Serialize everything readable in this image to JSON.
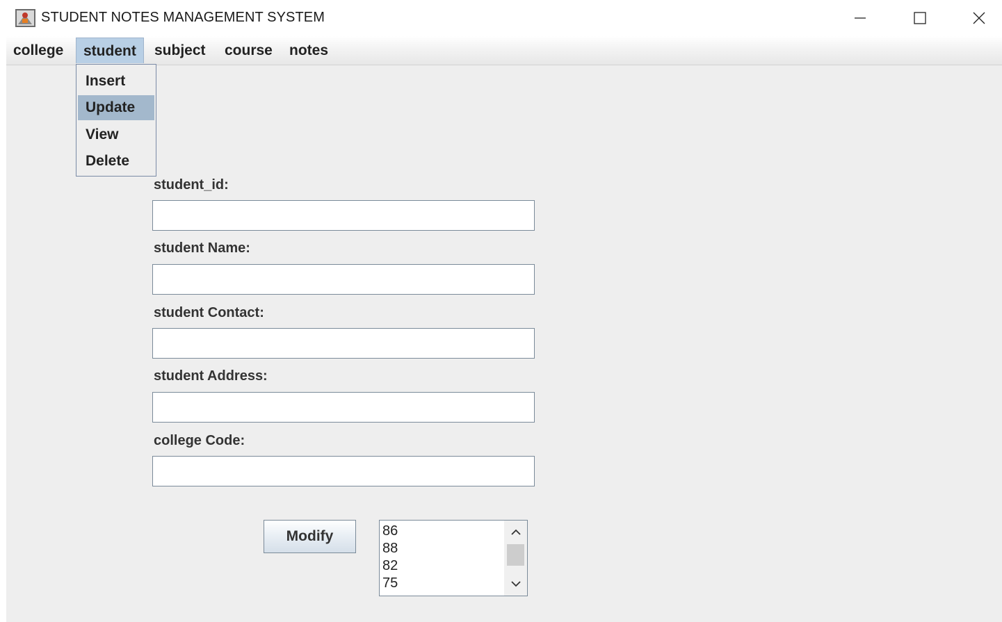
{
  "window": {
    "title": "STUDENT NOTES MANAGEMENT SYSTEM"
  },
  "menubar": {
    "items": [
      {
        "label": "college"
      },
      {
        "label": "student"
      },
      {
        "label": "subject"
      },
      {
        "label": "course"
      },
      {
        "label": "notes"
      }
    ],
    "active": "student"
  },
  "dropdown": {
    "items": [
      {
        "label": "Insert"
      },
      {
        "label": "Update"
      },
      {
        "label": "View"
      },
      {
        "label": "Delete"
      }
    ],
    "selected": "Update"
  },
  "form": {
    "fields": [
      {
        "label": "student_id:",
        "value": ""
      },
      {
        "label": "student Name:",
        "value": ""
      },
      {
        "label": "student Contact:",
        "value": ""
      },
      {
        "label": "student Address:",
        "value": ""
      },
      {
        "label": "college Code:",
        "value": ""
      }
    ],
    "submit_label": "Modify"
  },
  "listbox": {
    "items": [
      "86",
      "88",
      "82",
      "75"
    ]
  },
  "icons": {
    "app": "java-app-icon",
    "minimize": "minimize-icon",
    "maximize": "maximize-icon",
    "close": "close-icon",
    "scroll_up": "chevron-up-icon",
    "scroll_down": "chevron-down-icon"
  },
  "colors": {
    "menu_active": "#b8cfe5",
    "dropdown_selected": "#a3b8cc",
    "panel_bg": "#eeeeee"
  }
}
